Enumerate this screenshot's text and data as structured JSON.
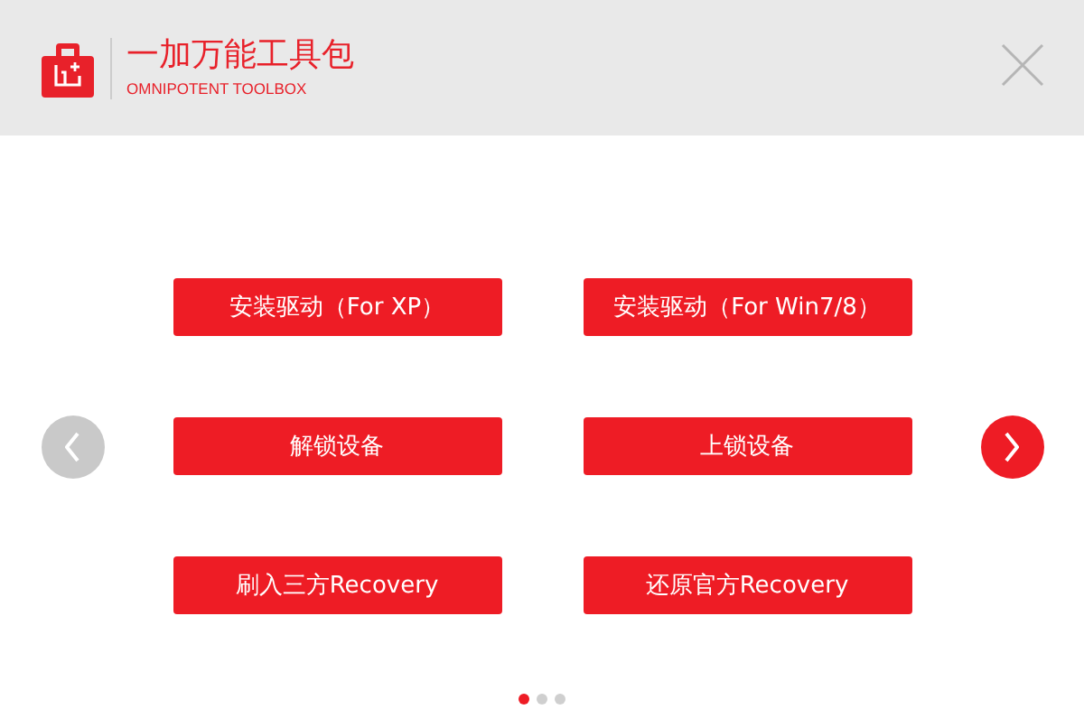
{
  "header": {
    "title": "一加万能工具包",
    "subtitle": "OMNIPOTENT TOOLBOX"
  },
  "buttons": [
    "安装驱动（For XP）",
    "安装驱动（For Win7/8）",
    "解锁设备",
    "上锁设备",
    "刷入三方Recovery",
    "还原官方Recovery"
  ],
  "prev_arrow": {
    "disabled": true
  },
  "next_arrow": {
    "disabled": false
  },
  "pages": [
    {
      "selected": true
    },
    {
      "selected": false
    },
    {
      "selected": false
    }
  ]
}
